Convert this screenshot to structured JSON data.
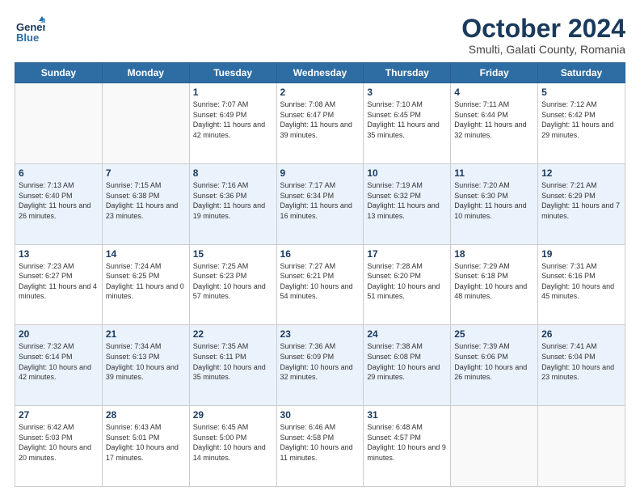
{
  "header": {
    "logo_line1": "General",
    "logo_line2": "Blue",
    "month_title": "October 2024",
    "subtitle": "Smulti, Galati County, Romania"
  },
  "weekdays": [
    "Sunday",
    "Monday",
    "Tuesday",
    "Wednesday",
    "Thursday",
    "Friday",
    "Saturday"
  ],
  "weeks": [
    [
      {
        "day": "",
        "sunrise": "",
        "sunset": "",
        "daylight": ""
      },
      {
        "day": "",
        "sunrise": "",
        "sunset": "",
        "daylight": ""
      },
      {
        "day": "1",
        "sunrise": "Sunrise: 7:07 AM",
        "sunset": "Sunset: 6:49 PM",
        "daylight": "Daylight: 11 hours and 42 minutes."
      },
      {
        "day": "2",
        "sunrise": "Sunrise: 7:08 AM",
        "sunset": "Sunset: 6:47 PM",
        "daylight": "Daylight: 11 hours and 39 minutes."
      },
      {
        "day": "3",
        "sunrise": "Sunrise: 7:10 AM",
        "sunset": "Sunset: 6:45 PM",
        "daylight": "Daylight: 11 hours and 35 minutes."
      },
      {
        "day": "4",
        "sunrise": "Sunrise: 7:11 AM",
        "sunset": "Sunset: 6:44 PM",
        "daylight": "Daylight: 11 hours and 32 minutes."
      },
      {
        "day": "5",
        "sunrise": "Sunrise: 7:12 AM",
        "sunset": "Sunset: 6:42 PM",
        "daylight": "Daylight: 11 hours and 29 minutes."
      }
    ],
    [
      {
        "day": "6",
        "sunrise": "Sunrise: 7:13 AM",
        "sunset": "Sunset: 6:40 PM",
        "daylight": "Daylight: 11 hours and 26 minutes."
      },
      {
        "day": "7",
        "sunrise": "Sunrise: 7:15 AM",
        "sunset": "Sunset: 6:38 PM",
        "daylight": "Daylight: 11 hours and 23 minutes."
      },
      {
        "day": "8",
        "sunrise": "Sunrise: 7:16 AM",
        "sunset": "Sunset: 6:36 PM",
        "daylight": "Daylight: 11 hours and 19 minutes."
      },
      {
        "day": "9",
        "sunrise": "Sunrise: 7:17 AM",
        "sunset": "Sunset: 6:34 PM",
        "daylight": "Daylight: 11 hours and 16 minutes."
      },
      {
        "day": "10",
        "sunrise": "Sunrise: 7:19 AM",
        "sunset": "Sunset: 6:32 PM",
        "daylight": "Daylight: 11 hours and 13 minutes."
      },
      {
        "day": "11",
        "sunrise": "Sunrise: 7:20 AM",
        "sunset": "Sunset: 6:30 PM",
        "daylight": "Daylight: 11 hours and 10 minutes."
      },
      {
        "day": "12",
        "sunrise": "Sunrise: 7:21 AM",
        "sunset": "Sunset: 6:29 PM",
        "daylight": "Daylight: 11 hours and 7 minutes."
      }
    ],
    [
      {
        "day": "13",
        "sunrise": "Sunrise: 7:23 AM",
        "sunset": "Sunset: 6:27 PM",
        "daylight": "Daylight: 11 hours and 4 minutes."
      },
      {
        "day": "14",
        "sunrise": "Sunrise: 7:24 AM",
        "sunset": "Sunset: 6:25 PM",
        "daylight": "Daylight: 11 hours and 0 minutes."
      },
      {
        "day": "15",
        "sunrise": "Sunrise: 7:25 AM",
        "sunset": "Sunset: 6:23 PM",
        "daylight": "Daylight: 10 hours and 57 minutes."
      },
      {
        "day": "16",
        "sunrise": "Sunrise: 7:27 AM",
        "sunset": "Sunset: 6:21 PM",
        "daylight": "Daylight: 10 hours and 54 minutes."
      },
      {
        "day": "17",
        "sunrise": "Sunrise: 7:28 AM",
        "sunset": "Sunset: 6:20 PM",
        "daylight": "Daylight: 10 hours and 51 minutes."
      },
      {
        "day": "18",
        "sunrise": "Sunrise: 7:29 AM",
        "sunset": "Sunset: 6:18 PM",
        "daylight": "Daylight: 10 hours and 48 minutes."
      },
      {
        "day": "19",
        "sunrise": "Sunrise: 7:31 AM",
        "sunset": "Sunset: 6:16 PM",
        "daylight": "Daylight: 10 hours and 45 minutes."
      }
    ],
    [
      {
        "day": "20",
        "sunrise": "Sunrise: 7:32 AM",
        "sunset": "Sunset: 6:14 PM",
        "daylight": "Daylight: 10 hours and 42 minutes."
      },
      {
        "day": "21",
        "sunrise": "Sunrise: 7:34 AM",
        "sunset": "Sunset: 6:13 PM",
        "daylight": "Daylight: 10 hours and 39 minutes."
      },
      {
        "day": "22",
        "sunrise": "Sunrise: 7:35 AM",
        "sunset": "Sunset: 6:11 PM",
        "daylight": "Daylight: 10 hours and 35 minutes."
      },
      {
        "day": "23",
        "sunrise": "Sunrise: 7:36 AM",
        "sunset": "Sunset: 6:09 PM",
        "daylight": "Daylight: 10 hours and 32 minutes."
      },
      {
        "day": "24",
        "sunrise": "Sunrise: 7:38 AM",
        "sunset": "Sunset: 6:08 PM",
        "daylight": "Daylight: 10 hours and 29 minutes."
      },
      {
        "day": "25",
        "sunrise": "Sunrise: 7:39 AM",
        "sunset": "Sunset: 6:06 PM",
        "daylight": "Daylight: 10 hours and 26 minutes."
      },
      {
        "day": "26",
        "sunrise": "Sunrise: 7:41 AM",
        "sunset": "Sunset: 6:04 PM",
        "daylight": "Daylight: 10 hours and 23 minutes."
      }
    ],
    [
      {
        "day": "27",
        "sunrise": "Sunrise: 6:42 AM",
        "sunset": "Sunset: 5:03 PM",
        "daylight": "Daylight: 10 hours and 20 minutes."
      },
      {
        "day": "28",
        "sunrise": "Sunrise: 6:43 AM",
        "sunset": "Sunset: 5:01 PM",
        "daylight": "Daylight: 10 hours and 17 minutes."
      },
      {
        "day": "29",
        "sunrise": "Sunrise: 6:45 AM",
        "sunset": "Sunset: 5:00 PM",
        "daylight": "Daylight: 10 hours and 14 minutes."
      },
      {
        "day": "30",
        "sunrise": "Sunrise: 6:46 AM",
        "sunset": "Sunset: 4:58 PM",
        "daylight": "Daylight: 10 hours and 11 minutes."
      },
      {
        "day": "31",
        "sunrise": "Sunrise: 6:48 AM",
        "sunset": "Sunset: 4:57 PM",
        "daylight": "Daylight: 10 hours and 9 minutes."
      },
      {
        "day": "",
        "sunrise": "",
        "sunset": "",
        "daylight": ""
      },
      {
        "day": "",
        "sunrise": "",
        "sunset": "",
        "daylight": ""
      }
    ]
  ]
}
